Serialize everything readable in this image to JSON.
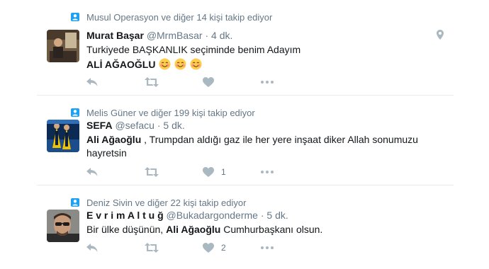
{
  "tweets": [
    {
      "context": "Musul Operasyon ve diğer 14 kişi takip ediyor",
      "name": "Murat Başar",
      "handle": "@MrmBasar",
      "dot": "·",
      "time": "4 dk.",
      "line1": "Turkiyede BAŞKANLIK seçiminde benim Adayım",
      "line2": "ALİ AĞAOĞLU",
      "emoji_count": 3,
      "likes": "",
      "has_geo": true
    },
    {
      "context": "Melis Güner ve diğer 199 kişi takip ediyor",
      "name": "SEFA",
      "handle": "@sefacu",
      "dot": "·",
      "time": "5 dk.",
      "text_bold": "Ali Ağaoğlu",
      "text_rest": " , Trumpdan aldığı gaz ile her yere inşaat diker  Allah sonumuzu",
      "text_line2": "hayretsin",
      "likes": "1"
    },
    {
      "context": "Deniz Sivin ve diğer 22 kişi takip ediyor",
      "name": "E v r i m A l t u ğ",
      "handle": "@Bukadargonderme",
      "dot": "·",
      "time": "5 dk.",
      "text_pre": "Bir ülke düşünün, ",
      "text_bold": "Ali Ağaoğlu",
      "text_post": " Cumhurbaşkanı olsun.",
      "likes": "2"
    }
  ],
  "colors": {
    "icon_gray": "#aab8c2",
    "context_icon": "#1da1f2",
    "meta_gray": "#657786",
    "divider": "#e6ecf0"
  },
  "icons": {
    "context": "person-follow-icon",
    "reply": "reply-icon",
    "retweet": "retweet-icon",
    "like": "heart-icon",
    "more": "more-dots-icon",
    "geo": "location-pin-icon",
    "emoji": "smiling-face-emoji"
  }
}
